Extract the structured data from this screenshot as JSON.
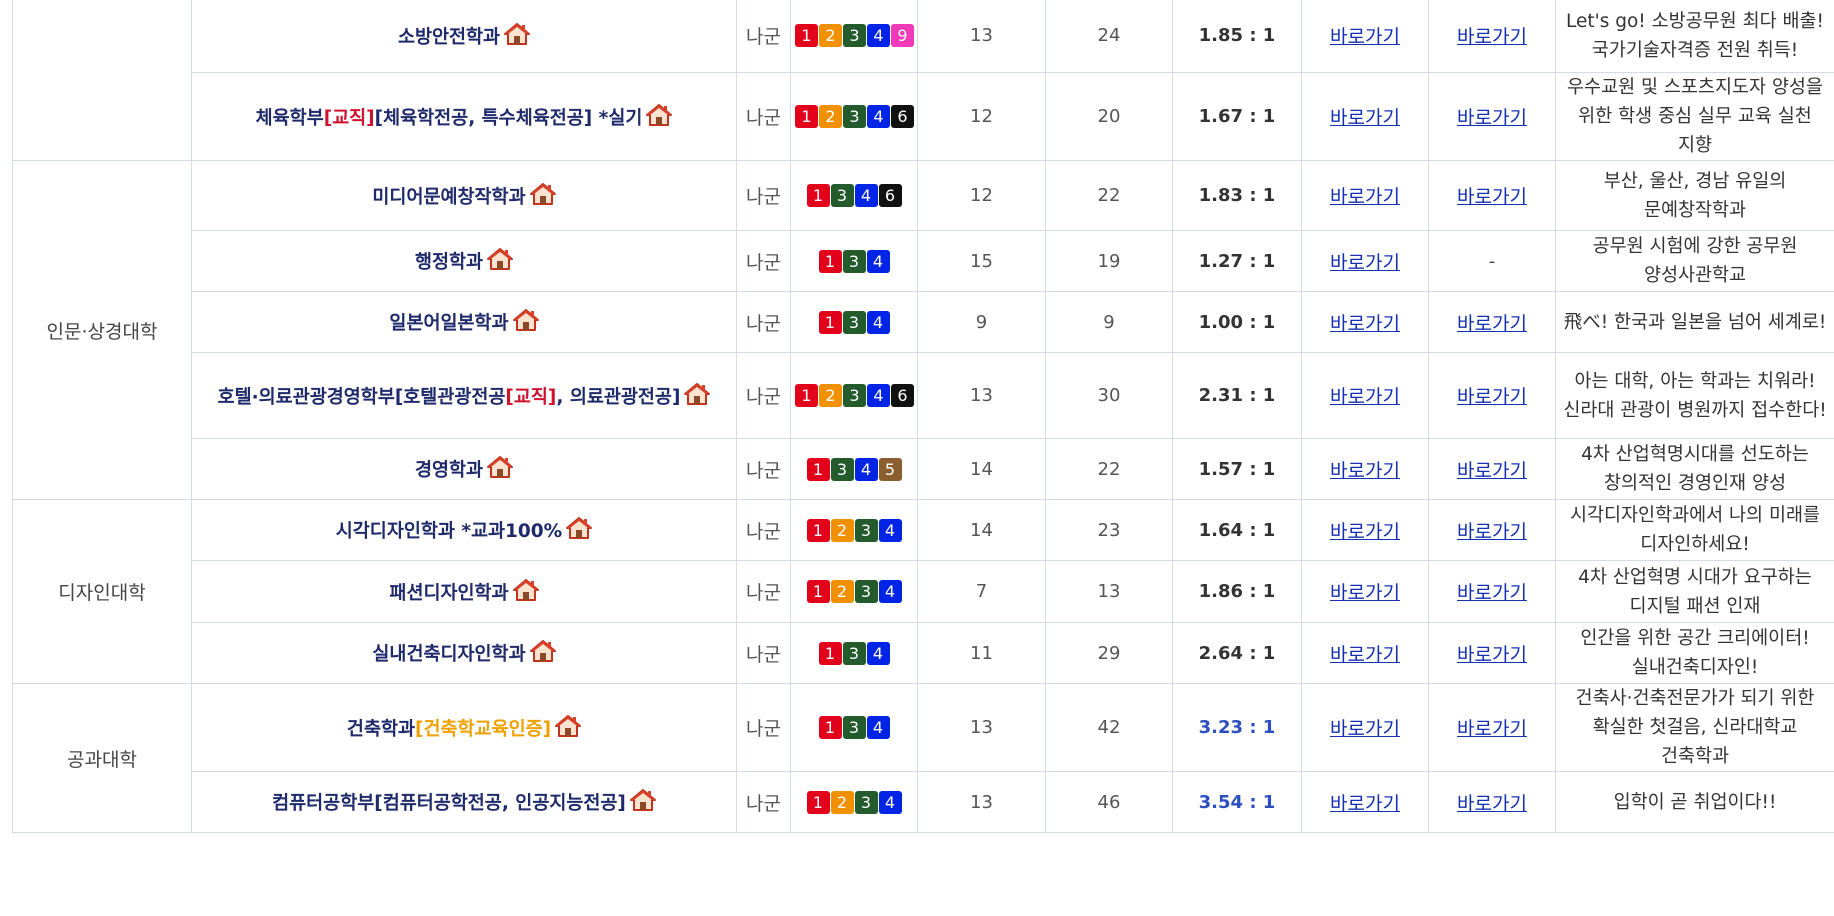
{
  "colors": {
    "badge_1": "#e3001b",
    "badge_2": "#f19100",
    "badge_3": "#235b2c",
    "badge_4": "#0024e6",
    "badge_5": "#8b5e30",
    "badge_6": "#111111",
    "badge_9": "#f03ab9",
    "link": "#1530b0",
    "highlight_ratio": "#2b4fc0"
  },
  "icons": {
    "home": "home-icon"
  },
  "link_label": "바로가기",
  "rows": [
    {
      "college": "",
      "name": "소방안전학과",
      "notes": [],
      "group": "나군",
      "badges": [
        1,
        2,
        3,
        4,
        9
      ],
      "quota": "13",
      "applicants": "24",
      "ratio": "1.85 : 1",
      "link1": "바로가기",
      "link2": "바로가기",
      "desc": "Let's go! 소방공무원 최다 배출! 국가기술자격증 전원 취득!"
    },
    {
      "college": "",
      "name": "체육학부",
      "notes": [
        {
          "text": "[교직]",
          "color": "red"
        },
        {
          "text": "[체육학전공, 특수체육전공] *실기",
          "color": "navy"
        }
      ],
      "group": "나군",
      "badges": [
        1,
        2,
        3,
        4,
        6
      ],
      "quota": "12",
      "applicants": "20",
      "ratio": "1.67 : 1",
      "link1": "바로가기",
      "link2": "바로가기",
      "desc": "우수교원 및 스포츠지도자 양성을 위한 학생 중심 실무 교육 실천 지향"
    },
    {
      "college": "인문·상경대학",
      "name": "미디어문예창작학과",
      "notes": [],
      "group": "나군",
      "badges": [
        1,
        3,
        4,
        6
      ],
      "quota": "12",
      "applicants": "22",
      "ratio": "1.83 : 1",
      "link1": "바로가기",
      "link2": "바로가기",
      "desc": "부산, 울산, 경남 유일의 문예창작학과"
    },
    {
      "college": "",
      "name": "행정학과",
      "notes": [],
      "group": "나군",
      "badges": [
        1,
        3,
        4
      ],
      "quota": "15",
      "applicants": "19",
      "ratio": "1.27 : 1",
      "link1": "바로가기",
      "link2": "-",
      "desc": "공무원 시험에 강한 공무원 양성사관학교"
    },
    {
      "college": "",
      "name": "일본어일본학과",
      "notes": [],
      "group": "나군",
      "badges": [
        1,
        3,
        4
      ],
      "quota": "9",
      "applicants": "9",
      "ratio": "1.00 : 1",
      "link1": "바로가기",
      "link2": "바로가기",
      "desc": "飛べ! 한국과 일본을 넘어 세계로!"
    },
    {
      "college": "",
      "name": "호텔·의료관광경영학부",
      "notes": [
        {
          "text": "[호텔관광전공",
          "color": "navy"
        },
        {
          "text": "[교직]",
          "color": "red"
        },
        {
          "text": ", 의료관광전공]",
          "color": "navy"
        }
      ],
      "group": "나군",
      "badges": [
        1,
        2,
        3,
        4,
        6
      ],
      "quota": "13",
      "applicants": "30",
      "ratio": "2.31 : 1",
      "link1": "바로가기",
      "link2": "바로가기",
      "desc": "아는 대학, 아는 학과는 치워라! 신라대 관광이 병원까지 접수한다!"
    },
    {
      "college": "",
      "name": "경영학과",
      "notes": [],
      "group": "나군",
      "badges": [
        1,
        3,
        4,
        5
      ],
      "quota": "14",
      "applicants": "22",
      "ratio": "1.57 : 1",
      "link1": "바로가기",
      "link2": "바로가기",
      "desc": "4차 산업혁명시대를 선도하는 창의적인 경영인재 양성"
    },
    {
      "college": "디자인대학",
      "name": "시각디자인학과",
      "notes": [
        {
          "text": " *교과100%",
          "color": "navy"
        }
      ],
      "group": "나군",
      "badges": [
        1,
        2,
        3,
        4
      ],
      "quota": "14",
      "applicants": "23",
      "ratio": "1.64 : 1",
      "link1": "바로가기",
      "link2": "바로가기",
      "desc": "시각디자인학과에서 나의 미래를 디자인하세요!"
    },
    {
      "college": "",
      "name": "패션디자인학과",
      "notes": [],
      "group": "나군",
      "badges": [
        1,
        2,
        3,
        4
      ],
      "quota": "7",
      "applicants": "13",
      "ratio": "1.86 : 1",
      "link1": "바로가기",
      "link2": "바로가기",
      "desc": "4차 산업혁명 시대가 요구하는 디지털 패션 인재"
    },
    {
      "college": "",
      "name": "실내건축디자인학과",
      "notes": [],
      "group": "나군",
      "badges": [
        1,
        3,
        4
      ],
      "quota": "11",
      "applicants": "29",
      "ratio": "2.64 : 1",
      "link1": "바로가기",
      "link2": "바로가기",
      "desc": "인간을 위한 공간 크리에이터! 실내건축디자인!"
    },
    {
      "college": "공과대학",
      "name": "건축학과",
      "notes": [
        {
          "text": "[건축학교육인증]",
          "color": "orange"
        }
      ],
      "group": "나군",
      "badges": [
        1,
        3,
        4
      ],
      "quota": "13",
      "applicants": "42",
      "ratio": "3.23 : 1",
      "link1": "바로가기",
      "link2": "바로가기",
      "desc": "건축사·건축전문가가 되기 위한 확실한 첫걸음, 신라대학교 건축학과"
    },
    {
      "college": "",
      "name": "컴퓨터공학부",
      "notes": [
        {
          "text": "[컴퓨터공학전공, 인공지능전공]",
          "color": "navy"
        }
      ],
      "group": "나군",
      "badges": [
        1,
        2,
        3,
        4
      ],
      "quota": "13",
      "applicants": "46",
      "ratio": "3.54 : 1",
      "link1": "바로가기",
      "link2": "바로가기",
      "desc": "입학이 곧 취업이다!!"
    }
  ]
}
